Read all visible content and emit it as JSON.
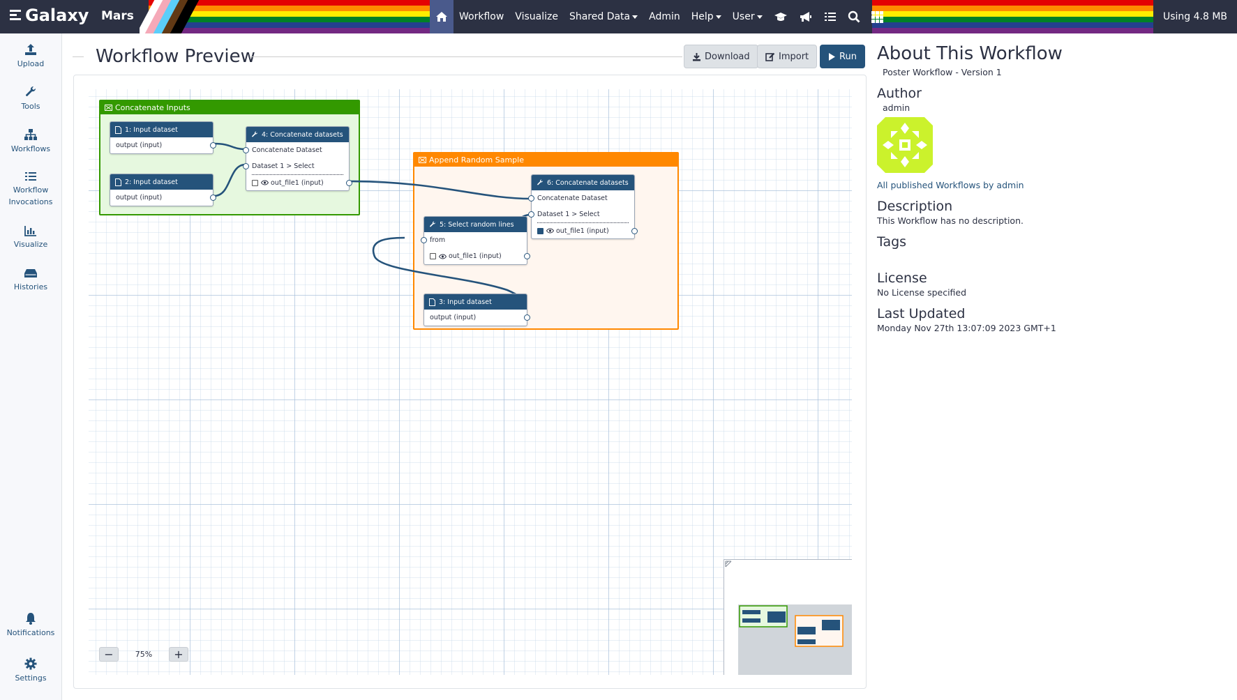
{
  "brand": {
    "name": "Galaxy",
    "instance": "Mars"
  },
  "nav": {
    "items": [
      "Workflow",
      "Visualize",
      "Shared Data",
      "Admin",
      "Help",
      "User"
    ],
    "icons": [
      "home-icon",
      "graduation-cap-icon",
      "megaphone-icon",
      "list-icon",
      "search-icon",
      "grid-icon"
    ]
  },
  "quota": "Using 4.8 MB",
  "sidebar": {
    "items": [
      {
        "label": "Upload",
        "icon": "upload-icon"
      },
      {
        "label": "Tools",
        "icon": "wrench-icon"
      },
      {
        "label": "Workflows",
        "icon": "sitemap-icon"
      },
      {
        "label": "Workflow Invocations",
        "icon": "list-icon"
      },
      {
        "label": "Visualize",
        "icon": "chart-icon"
      },
      {
        "label": "Histories",
        "icon": "hdd-icon"
      }
    ],
    "bottom": [
      {
        "label": "Notifications",
        "icon": "bell-icon"
      },
      {
        "label": "Settings",
        "icon": "gear-icon"
      }
    ]
  },
  "main": {
    "title": "Workflow Preview",
    "buttons": {
      "download": "Download",
      "import": "Import",
      "run": "Run"
    }
  },
  "workflow": {
    "comments": [
      {
        "title": "Concatenate Inputs",
        "color": "#339900"
      },
      {
        "title": "Append Random Sample",
        "color": "#ff8800"
      }
    ],
    "nodes": [
      {
        "title": "1: Input dataset",
        "rows": [
          "output (input)"
        ]
      },
      {
        "title": "2: Input dataset",
        "rows": [
          "output (input)"
        ]
      },
      {
        "title": "4: Concatenate datasets",
        "rows": [
          "Concatenate Dataset",
          "Dataset 1 > Select",
          "out_file1 (input)"
        ]
      },
      {
        "title": "6: Concatenate datasets",
        "rows": [
          "Concatenate Dataset",
          "Dataset 1 > Select",
          "out_file1 (input)"
        ]
      },
      {
        "title": "5: Select random lines",
        "rows": [
          "from",
          "out_file1 (input)"
        ]
      },
      {
        "title": "3: Input dataset",
        "rows": [
          "output (input)"
        ]
      }
    ],
    "zoom": "75%",
    "zoom_out": "−",
    "zoom_in": "+"
  },
  "about": {
    "heading": "About This Workflow",
    "name": "Poster Workflow - Version 1",
    "author_heading": "Author",
    "author": "admin",
    "published_link": "All published Workflows by admin",
    "description_heading": "Description",
    "description": "This Workflow has no description.",
    "tags_heading": "Tags",
    "license_heading": "License",
    "license": "No License specified",
    "updated_heading": "Last Updated",
    "updated": "Monday Nov 27th 13:07:09 2023 GMT+1"
  }
}
